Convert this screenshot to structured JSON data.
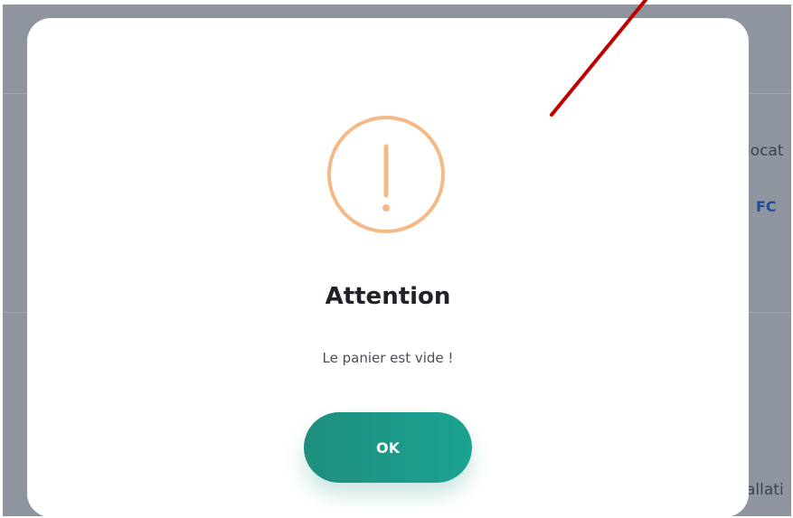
{
  "background": {
    "fragments": {
      "location_partial": "locat",
      "club_partial": "FC",
      "installation_partial": "allati"
    }
  },
  "dialog": {
    "icon": "exclamation-circle-icon",
    "icon_color": "#f5b887",
    "title": "Attention",
    "message": "Le panier est vide !",
    "ok_label": "OK",
    "button_color": "#1a9a88"
  },
  "annotation": {
    "arrow_color": "#c00000"
  }
}
